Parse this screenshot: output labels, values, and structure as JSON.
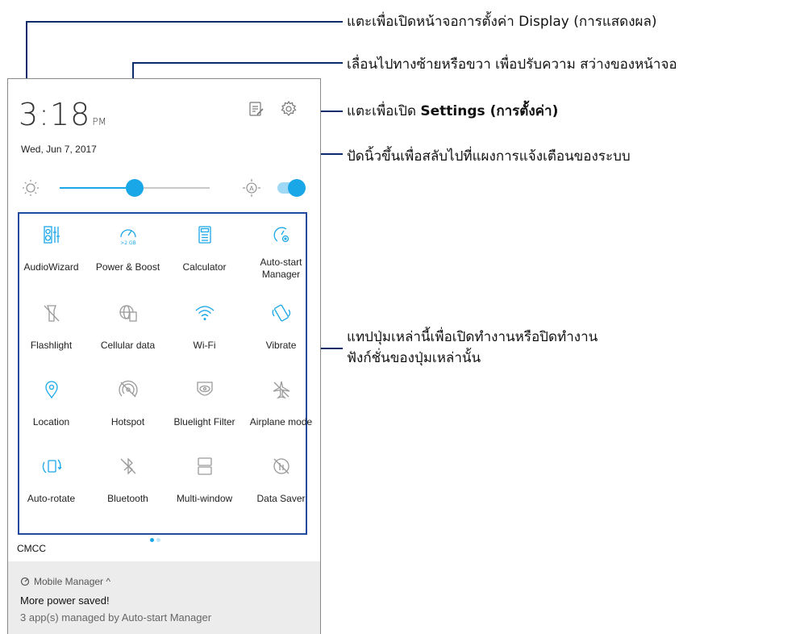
{
  "status": {
    "time": "3:18",
    "ampm": "PM",
    "date": "Wed, Jun 7, 2017"
  },
  "header_icons": [
    "edit-list-icon",
    "gear-icon"
  ],
  "brightness": {
    "level": 0.5,
    "auto_icon": "auto-brightness-icon",
    "auto_enabled": true
  },
  "tiles": [
    {
      "label": "AudioWizard",
      "icon": "equalizer-icon",
      "active": true
    },
    {
      "label": "Power & Boost",
      "icon": "speedometer-icon",
      "active": true,
      "sub": ">2 GB"
    },
    {
      "label": "Calculator",
      "icon": "calculator-icon",
      "active": true
    },
    {
      "label": "Auto-start\nManager",
      "icon": "auto-start-icon",
      "active": true
    },
    {
      "label": "Flashlight",
      "icon": "flashlight-off-icon",
      "active": false
    },
    {
      "label": "Cellular data",
      "icon": "cellular-globe-icon",
      "active": false
    },
    {
      "label": "Wi-Fi",
      "icon": "wifi-icon",
      "active": true
    },
    {
      "label": "Vibrate",
      "icon": "vibrate-icon",
      "active": true
    },
    {
      "label": "Location",
      "icon": "location-pin-icon",
      "active": true
    },
    {
      "label": "Hotspot",
      "icon": "hotspot-off-icon",
      "active": false
    },
    {
      "label": "Bluelight Filter",
      "icon": "eye-filter-icon",
      "active": false
    },
    {
      "label": "Airplane mode",
      "icon": "airplane-icon",
      "active": false
    },
    {
      "label": "Auto-rotate",
      "icon": "auto-rotate-icon",
      "active": true
    },
    {
      "label": "Bluetooth",
      "icon": "bluetooth-off-icon",
      "active": false
    },
    {
      "label": "Multi-window",
      "icon": "multi-window-icon",
      "active": false
    },
    {
      "label": "Data Saver",
      "icon": "data-saver-off-icon",
      "active": false
    }
  ],
  "carrier": "CMCC",
  "notification": {
    "app": "Mobile Manager ^",
    "title": "More power saved!",
    "body": "3 app(s) managed by Auto-start Manager"
  },
  "callouts": {
    "display": "แตะเพื่อเปิดหน้าจอการตั้งค่า Display (การแสดงผล)",
    "brightness": "เลื่อนไปทางซ้ายหรือขวา เพื่อปรับความ สว่างของหน้าจอ",
    "settings_prefix": "แตะเพื่อเปิด ",
    "settings_bold": "Settings (การตั้งค่า)",
    "swipe": "ปัดนิ้วขึ้นเพื่อสลับไปที่แผงการแจ้งเตือนของระบบ",
    "tiles_line1": "แทปปุ่มเหล่านี้เพื่อเปิดทำงานหรือปิดทำงาน",
    "tiles_line2": "ฟังก์ชั่นของปุ่มเหล่านั้น"
  },
  "colors": {
    "accent": "#1aa7e8",
    "inactive": "#9a9a9a",
    "callout_line": "#0b2c6b",
    "box": "#1f4aa0"
  }
}
